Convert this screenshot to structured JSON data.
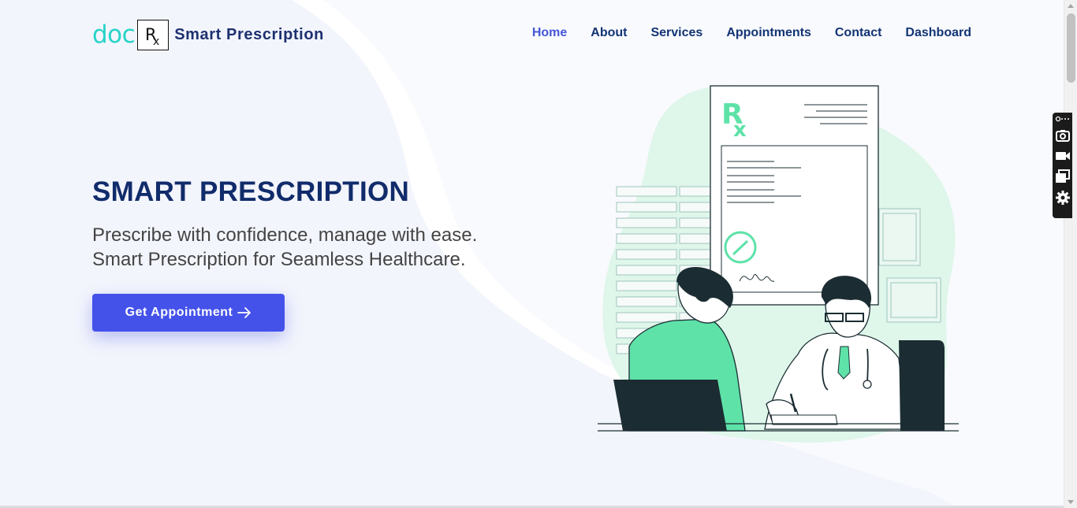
{
  "brand": {
    "logo_prefix": "doc",
    "logo_mark": "Rx",
    "name": "Smart Prescription"
  },
  "nav": {
    "items": [
      {
        "label": "Home",
        "active": true
      },
      {
        "label": "About",
        "active": false
      },
      {
        "label": "Services",
        "active": false
      },
      {
        "label": "Appointments",
        "active": false
      },
      {
        "label": "Contact",
        "active": false
      },
      {
        "label": "Dashboard",
        "active": false
      }
    ]
  },
  "hero": {
    "title": "SMART PRESCRIPTION",
    "subtitle_line1": "Prescribe with confidence, manage with ease.",
    "subtitle_line2": "Smart Prescription for Seamless Healthcare.",
    "cta_label": "Get Appointment",
    "cta_icon": "arrow-right-icon"
  },
  "illustration": {
    "name": "doctor-consultation-illustration",
    "prescription_mark": "Rx",
    "accent_color": "#5ee2a8"
  },
  "tools_panel": {
    "icons": [
      "link-icon",
      "more-icon",
      "camera-icon",
      "video-icon",
      "windows-icon",
      "gear-icon"
    ]
  },
  "colors": {
    "brand_teal": "#27d3c8",
    "nav_text": "#123474",
    "nav_active": "#4658d8",
    "title": "#112c6b",
    "cta": "#4452ea",
    "page_bg": "#f3f5fc"
  }
}
